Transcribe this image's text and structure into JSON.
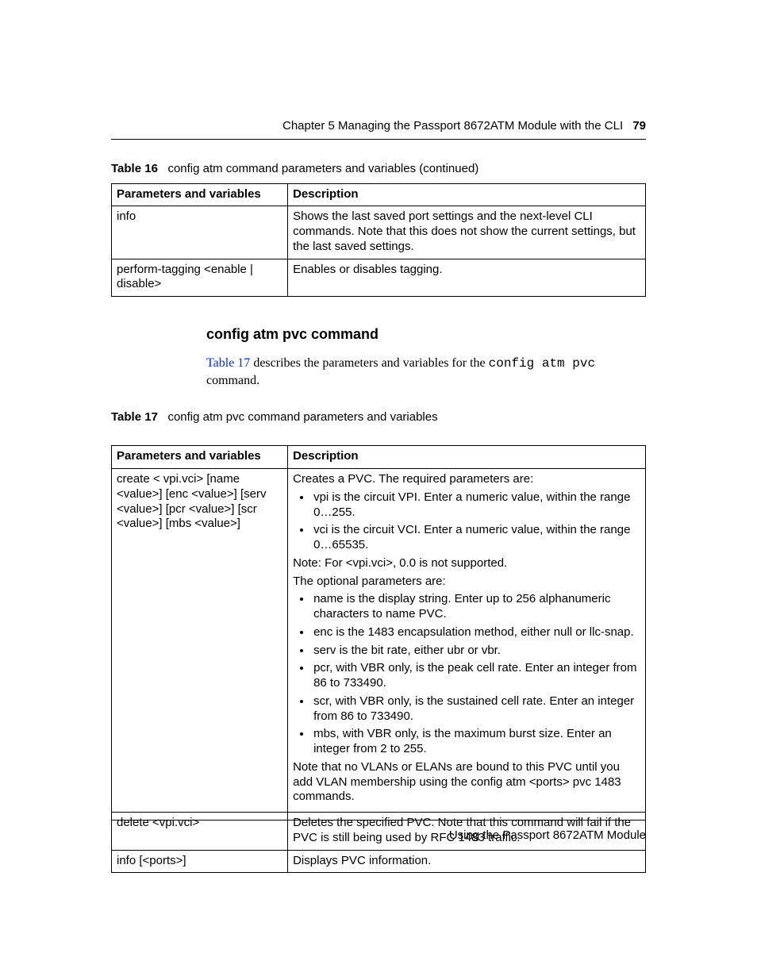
{
  "header": {
    "chapter_text": "Chapter 5  Managing the Passport 8672ATM Module with the CLI",
    "page_number": "79"
  },
  "table16": {
    "label": "Table 16",
    "caption": "config atm command parameters and variables (continued)",
    "head": {
      "param": "Parameters and variables",
      "desc": "Description"
    },
    "rows": [
      {
        "param": "info",
        "desc": "Shows the last saved port settings and the next-level CLI commands. Note that this does not show the current settings, but the last saved settings."
      },
      {
        "param": "perform-tagging <enable | disable>",
        "desc": "Enables or disables tagging."
      }
    ]
  },
  "section": {
    "heading": "config atm pvc command",
    "para_link": "Table 17",
    "para_mid": " describes the parameters and variables for the ",
    "para_mono": "config atm pvc",
    "para_tail": " command."
  },
  "table17": {
    "label": "Table 17",
    "caption": "config atm pvc command parameters and variables",
    "head": {
      "param": "Parameters and variables",
      "desc": "Description"
    },
    "rows": {
      "0": {
        "param": "create < vpi.vci> [name <value>] [enc <value>] [serv <value>] [pcr <value>] [scr <value>] [mbs <value>]",
        "desc": {
          "intro": "Creates a PVC. The required parameters are:",
          "req": [
            "vpi is the circuit VPI. Enter a numeric value, within the range 0…255.",
            "vci is the circuit VCI. Enter a numeric value, within the range 0…65535."
          ],
          "note1": "Note: For <vpi.vci>, 0.0 is not supported.",
          "opt_intro": "The optional parameters are:",
          "opt": [
            "name is the display string. Enter up to 256 alphanumeric characters to name PVC.",
            "enc is the 1483 encapsulation method, either null or llc-snap.",
            "serv is the bit rate, either ubr or vbr.",
            "pcr, with VBR only, is the peak cell rate. Enter an integer from 86 to 733490.",
            "scr, with VBR only, is the sustained cell rate. Enter an integer from 86 to 733490.",
            "mbs, with VBR only, is the maximum burst size. Enter an integer from 2 to 255."
          ],
          "note2": "Note that no VLANs or ELANs are bound to this PVC until you add VLAN membership using the config atm <ports> pvc 1483 commands."
        }
      },
      "1": {
        "param": "delete <vpi.vci>",
        "desc": "Deletes the specified PVC. Note that this command will fail if the PVC is still being used by RFC 1483 traffic."
      },
      "2": {
        "param": "info [<ports>]",
        "desc": "Displays PVC information."
      }
    }
  },
  "footer": {
    "text": "Using the Passport 8672ATM Module"
  }
}
